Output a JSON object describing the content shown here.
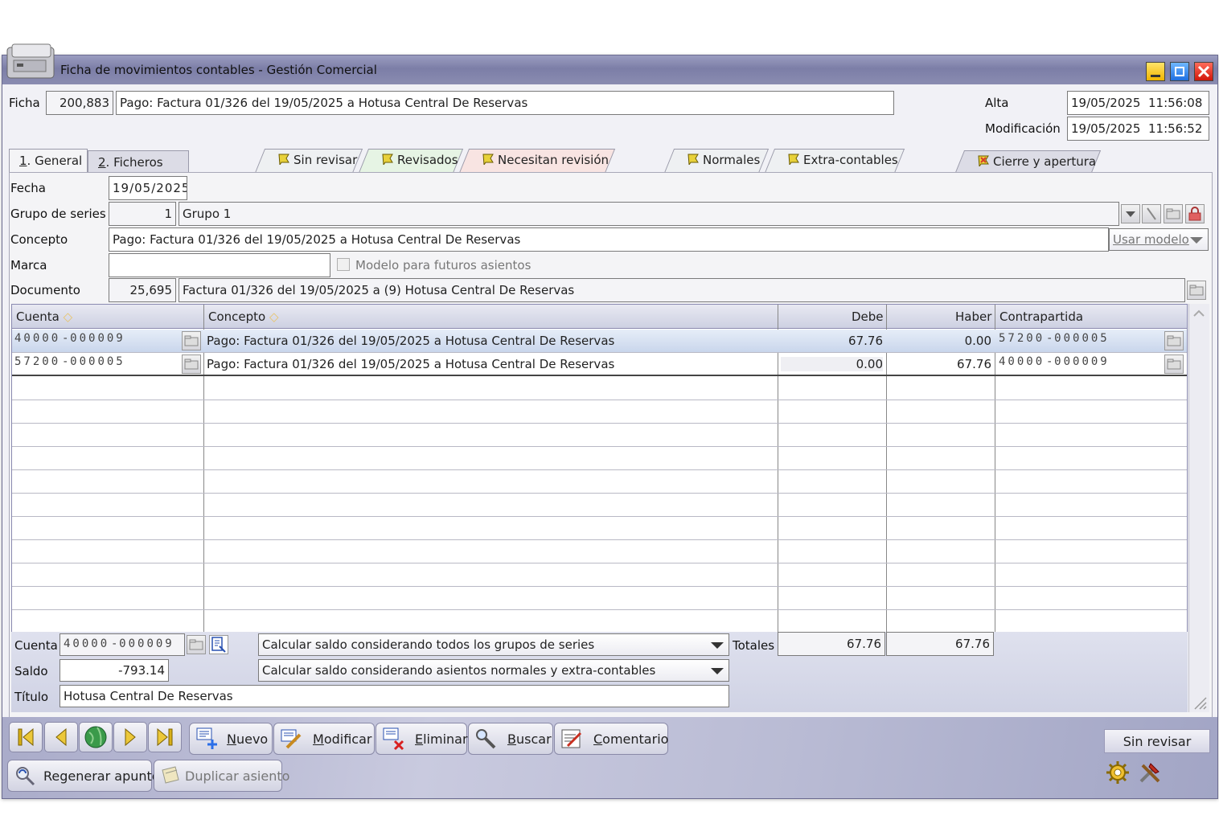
{
  "window": {
    "title": "Ficha de movimientos contables - Gestión Comercial"
  },
  "header": {
    "ficha_label": "Ficha",
    "ficha_number": "200,883",
    "ficha_description": "Pago: Factura 01/326 del 19/05/2025 a Hotusa Central De Reservas",
    "alta_label": "Alta",
    "alta_value": "19/05/2025  11:56:08",
    "modificacion_label": "Modificación",
    "modificacion_value": "19/05/2025  11:56:52"
  },
  "tabs": {
    "general": "1. General",
    "general_key": "1",
    "general_rest": ". General",
    "ficheros_key": "2",
    "ficheros_rest": ". Ficheros"
  },
  "filter_tabs": [
    "Sin revisar",
    "Revisados",
    "Necesitan revisión",
    "Normales",
    "Extra-contables",
    "Cierre y apertura"
  ],
  "form": {
    "fecha_label": "Fecha",
    "fecha_value": "19/05/2025",
    "grupo_label": "Grupo de series",
    "grupo_number": "1",
    "grupo_name": "Grupo 1",
    "concepto_label": "Concepto",
    "concepto_value": "Pago: Factura 01/326 del 19/05/2025 a Hotusa Central De Reservas",
    "usar_modelo": "Usar modelo",
    "marca_label": "Marca",
    "marca_value": "",
    "modelo_checkbox": "Modelo para futuros asientos",
    "documento_label": "Documento",
    "documento_number": "25,695",
    "documento_desc": "Factura 01/326 del 19/05/2025 a (9) Hotusa Central De Reservas"
  },
  "grid": {
    "headers": {
      "cuenta": "Cuenta",
      "concepto": "Concepto",
      "debe": "Debe",
      "haber": "Haber",
      "contrapartida": "Contrapartida"
    },
    "rows": [
      {
        "cuenta_a": "40000",
        "cuenta_b": "000009",
        "concepto": "Pago: Factura 01/326 del 19/05/2025 a Hotusa Central De Reservas",
        "debe": "67.76",
        "haber": "0.00",
        "contra_a": "57200",
        "contra_b": "000005"
      },
      {
        "cuenta_a": "57200",
        "cuenta_b": "000005",
        "concepto": "Pago: Factura 01/326 del 19/05/2025 a Hotusa Central De Reservas",
        "debe": "0.00",
        "haber": "67.76",
        "contra_a": "40000",
        "contra_b": "000009"
      }
    ]
  },
  "footer": {
    "cuenta_label": "Cuenta",
    "cuenta_a": "40000",
    "cuenta_b": "000009",
    "saldo_label": "Saldo",
    "saldo_value": "-793.14",
    "titulo_label": "Título",
    "titulo_value": "Hotusa Central De Reservas",
    "combo1": "Calcular saldo considerando todos los grupos de series",
    "combo2": "Calcular saldo considerando asientos normales y extra-contables",
    "totales_label": "Totales",
    "total_debe": "67.76",
    "total_haber": "67.76"
  },
  "toolbar": {
    "nuevo_key": "N",
    "nuevo_rest": "uevo",
    "modificar_key": "M",
    "modificar_rest": "odificar",
    "eliminar_key": "E",
    "eliminar_rest": "liminar",
    "buscar_key": "B",
    "buscar_rest": "uscar",
    "comentario_key": "C",
    "comentario_rest": "omentario",
    "regenerar": "Regenerar apuntes",
    "duplicar": "Duplicar asiento",
    "status": "Sin revisar"
  },
  "colors": {
    "accent": "#7c7ea7",
    "selected_row": "#c9d6ec",
    "flag_yellow": "#e8d13a",
    "flag_red": "#d83a2a"
  }
}
